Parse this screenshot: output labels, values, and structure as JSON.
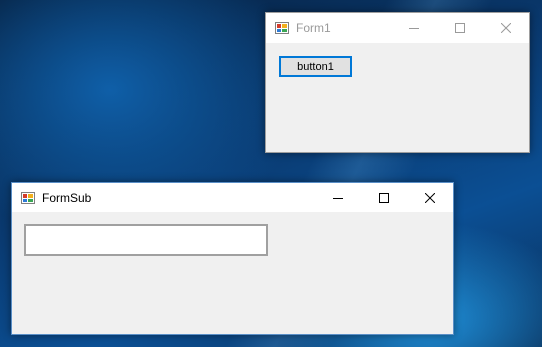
{
  "desktop": {
    "accent": "#0b4f94"
  },
  "windows": [
    {
      "title": "Form1",
      "state": "inactive",
      "icon": "winforms-app-icon",
      "caption_buttons": [
        "minimize-icon",
        "maximize-icon",
        "close-icon"
      ],
      "controls": {
        "button_label": "button1"
      }
    },
    {
      "title": "FormSub",
      "state": "active",
      "icon": "winforms-app-icon",
      "caption_buttons": [
        "minimize-icon",
        "maximize-icon",
        "close-icon"
      ],
      "controls": {
        "textbox_value": ""
      }
    }
  ],
  "colors": {
    "focus_border": "#0078d7",
    "window_bg": "#f0f0f0",
    "titlebar_bg": "#ffffff"
  }
}
